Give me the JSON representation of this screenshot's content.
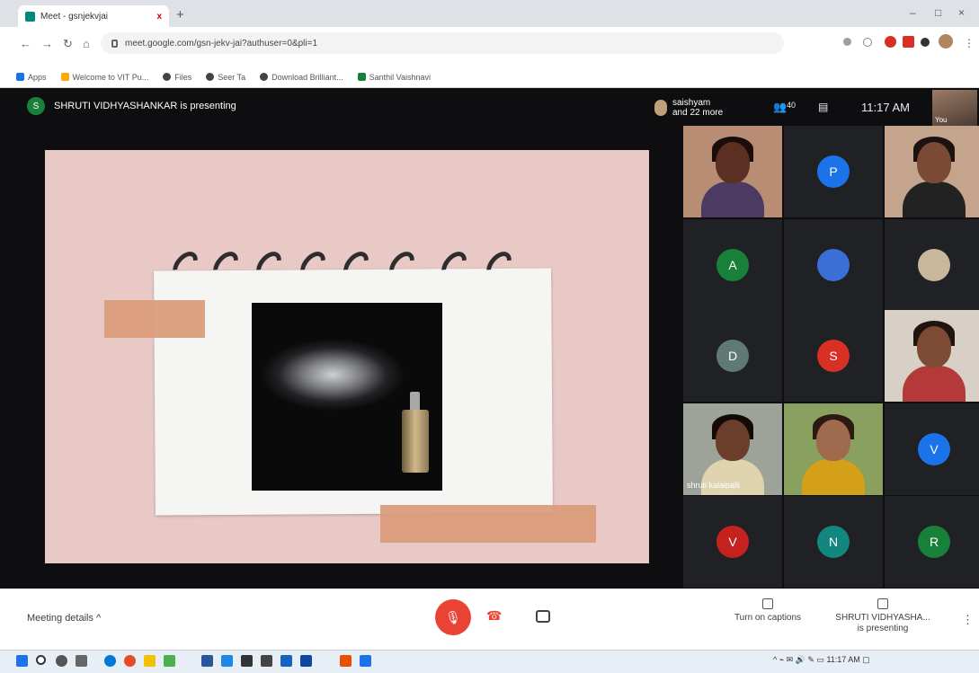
{
  "browser": {
    "tab_title": "Meet - gsnjekvjai",
    "tab_close": "x",
    "new_tab": "+",
    "window_controls": [
      "–",
      "□",
      "×"
    ],
    "url": "meet.google.com/gsn-jekv-jai?authuser=0&pli=1",
    "bookmarks": [
      "Apps",
      "Welcome to VIT Pu...",
      "Files",
      "Seer Ta",
      "Download Brilliant...",
      "Santhil Vaishnavi"
    ]
  },
  "meet": {
    "presenter_initial": "S",
    "presenting_text": "SHRUTI VIDHYASHANKAR is presenting",
    "viewers": [
      "saishyam",
      "and 22 more"
    ],
    "participant_count": "40",
    "time": "11:17 AM",
    "self_label": "You",
    "tiles": [
      {
        "kind": "video",
        "name": ""
      },
      {
        "kind": "avatar",
        "initial": "P",
        "color": "#1a73e8"
      },
      {
        "kind": "video",
        "name": ""
      },
      {
        "kind": "avatar",
        "initial": "A",
        "color": "#188038"
      },
      {
        "kind": "avatar-photo",
        "initial": "",
        "color": "#3b6fd6"
      },
      {
        "kind": "avatar-photo",
        "initial": "",
        "color": "#c9b79c"
      },
      {
        "kind": "avatar",
        "initial": "D",
        "color": "#5f7a73"
      },
      {
        "kind": "avatar",
        "initial": "S",
        "color": "#d93025"
      },
      {
        "kind": "video",
        "name": ""
      },
      {
        "kind": "video",
        "name": "shruti kalaipalli"
      },
      {
        "kind": "video",
        "name": ""
      },
      {
        "kind": "avatar",
        "initial": "V",
        "color": "#1a73e8"
      },
      {
        "kind": "avatar",
        "initial": "V",
        "color": "#c5221f"
      },
      {
        "kind": "avatar",
        "initial": "N",
        "color": "#12867f"
      },
      {
        "kind": "avatar",
        "initial": "R",
        "color": "#188038"
      }
    ]
  },
  "controls": {
    "meeting_details": "Meeting details",
    "meeting_details_chevron": "^",
    "captions": "Turn on captions",
    "presenting_now_line1": "SHRUTI VIDHYASHA...",
    "presenting_now_line2": "is presenting",
    "more": "⋮"
  },
  "taskbar": {
    "clock": "11:17 AM"
  },
  "colors": {
    "stage": "#0e0e10",
    "slide_pink": "#e9c9c6",
    "hangup": "#ea4335"
  }
}
